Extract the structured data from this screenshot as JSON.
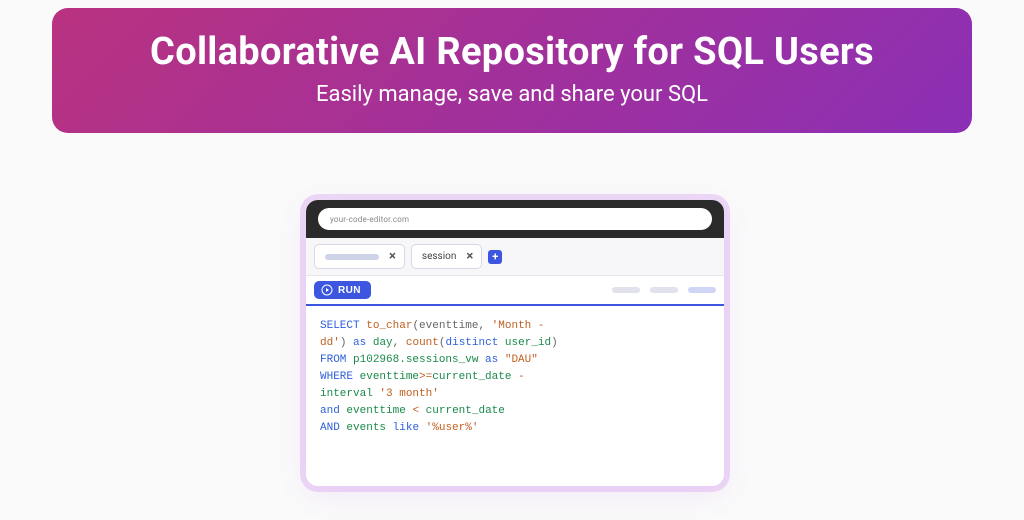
{
  "hero": {
    "title": "Collaborative AI Repository for SQL Users",
    "subtitle": "Easily manage, save and share your SQL"
  },
  "editor": {
    "url": "your-code-editor.com",
    "tabs": [
      {
        "label": "",
        "placeholder": true
      },
      {
        "label": "session",
        "placeholder": false
      }
    ],
    "addTabGlyph": "+",
    "runLabel": "RUN",
    "sql": {
      "line1_kw": "SELECT",
      "line1_fn": "to_char",
      "line1_args_open": "(eventtime",
      "line1_comma": ",",
      "line1_str": "'Month -",
      "line2_str": "dd'",
      "line2_paren": ")",
      "line2_as": "as",
      "line2_alias": "day",
      "line2_comma": ",",
      "line2_count": "count",
      "line2_count_args": "(",
      "line2_distinct": "distinct",
      "line2_userid": "user_id",
      "line2_close": ")",
      "line3_from": "FROM",
      "line3_table": "p102968.sessions_vw",
      "line3_as": "as",
      "line3_alias": "\"DAU\"",
      "line4_where": "WHERE",
      "line4_col": "eventtime",
      "line4_op": ">=",
      "line4_cd": "current_date",
      "line4_minus": "-",
      "line5_interval": "interval",
      "line5_str": "'3 month'",
      "line6_and": "and",
      "line6_col": "eventtime",
      "line6_lt": "<",
      "line6_cd": "current_date",
      "line7_and": "AND",
      "line7_col": "events",
      "line7_like": "like",
      "line7_str": "'%user%'"
    }
  }
}
